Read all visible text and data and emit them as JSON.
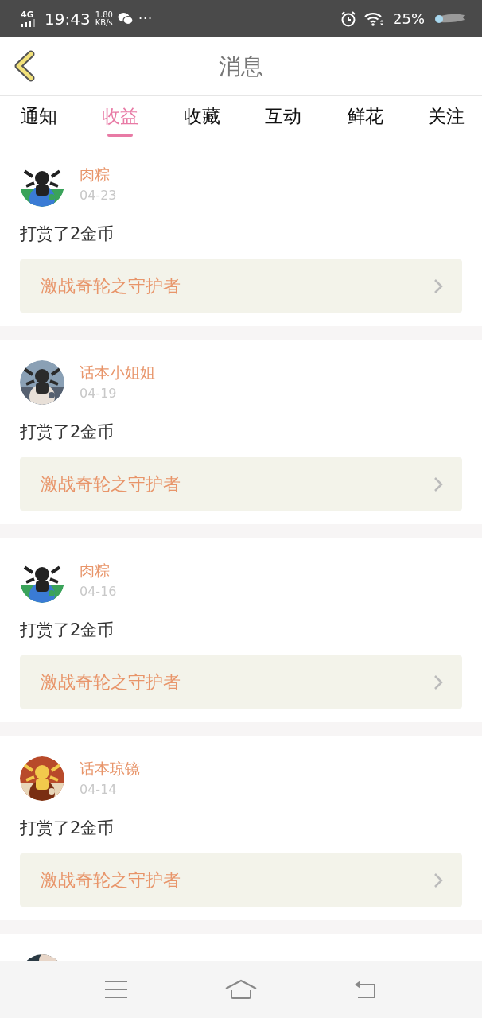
{
  "status_bar": {
    "network": "4G",
    "time": "19:43",
    "speed_value": "1.80",
    "speed_unit": "KB/s",
    "more": "···",
    "battery": "25%"
  },
  "header": {
    "title": "消息"
  },
  "tabs": [
    {
      "label": "通知",
      "selected": false
    },
    {
      "label": "收益",
      "selected": true
    },
    {
      "label": "收藏",
      "selected": false
    },
    {
      "label": "互动",
      "selected": false
    },
    {
      "label": "鲜花",
      "selected": false
    },
    {
      "label": "关注",
      "selected": false
    }
  ],
  "messages": [
    {
      "name": "肉粽",
      "date": "04-23",
      "text": "打赏了2金币",
      "link": "激战奇轮之守护者"
    },
    {
      "name": "话本小姐姐",
      "date": "04-19",
      "text": "打赏了2金币",
      "link": "激战奇轮之守护者"
    },
    {
      "name": "肉粽",
      "date": "04-16",
      "text": "打赏了2金币",
      "link": "激战奇轮之守护者"
    },
    {
      "name": "话本琼镜",
      "date": "04-14",
      "text": "打赏了2金币",
      "link": "激战奇轮之守护者"
    },
    {
      "kind": "partial"
    }
  ]
}
